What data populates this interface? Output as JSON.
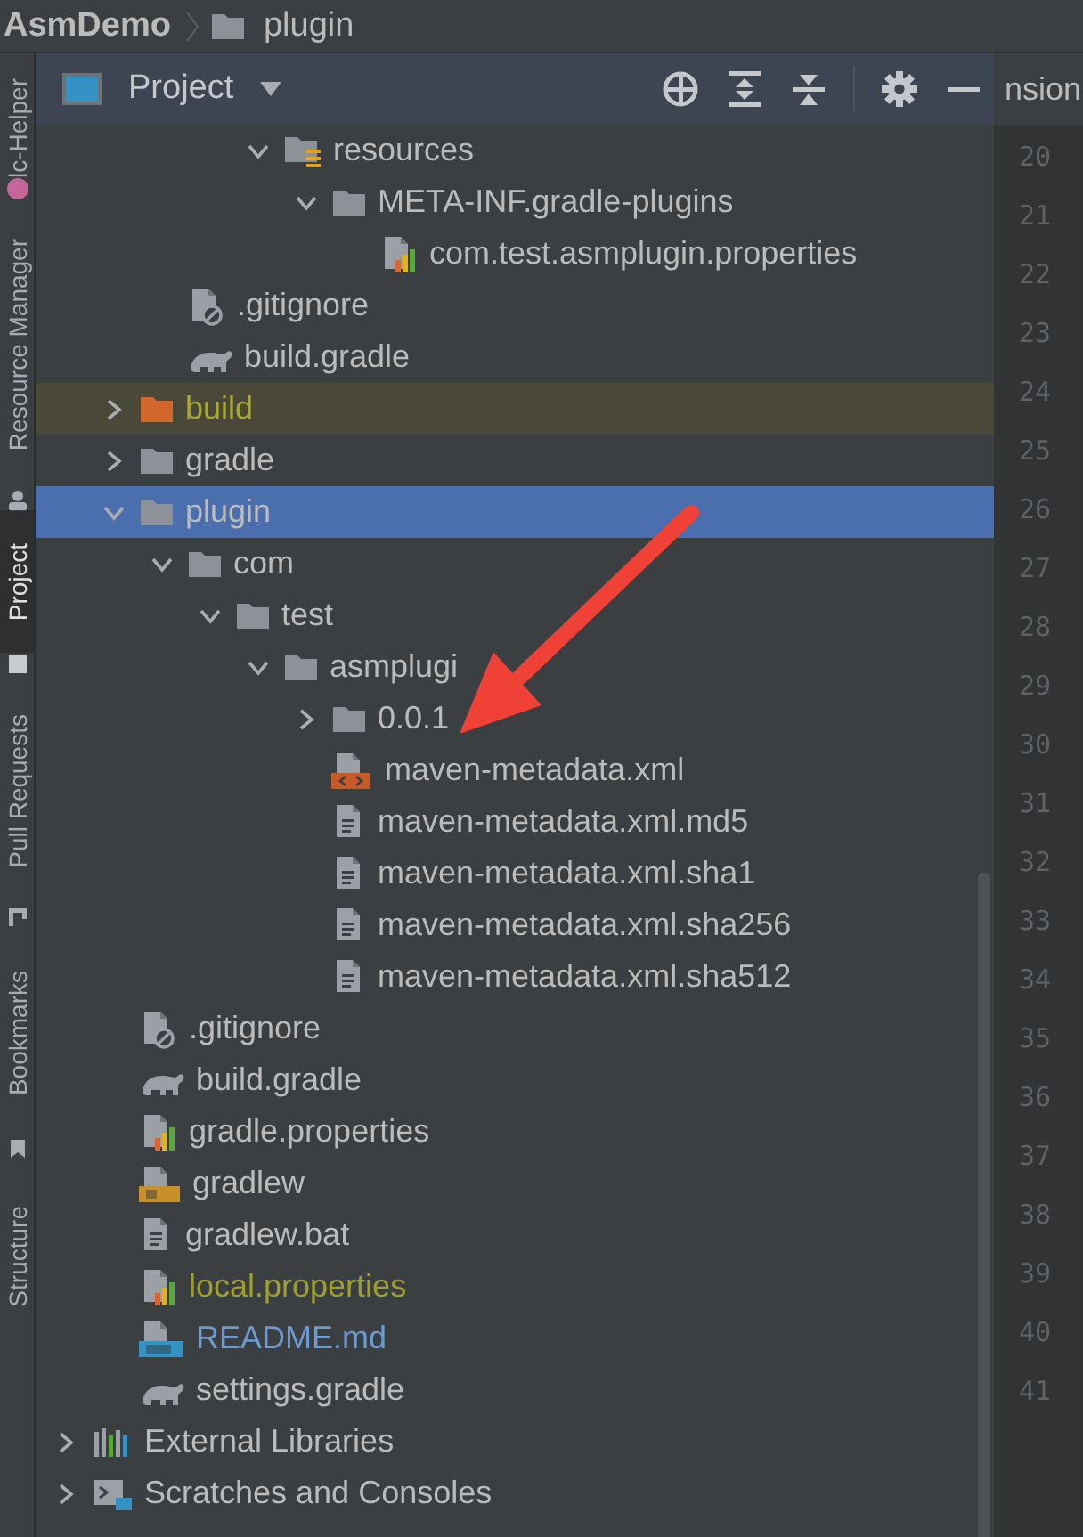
{
  "breadcrumb": [
    {
      "label": "AsmDemo",
      "kind": "project"
    },
    {
      "label": "plugin",
      "kind": "folder"
    }
  ],
  "tool_strip": [
    {
      "label": "lc-Helper",
      "selected": false
    },
    {
      "label": "Resource Manager",
      "selected": false
    },
    {
      "label": "Project",
      "selected": true
    },
    {
      "label": "Pull Requests",
      "selected": false
    },
    {
      "label": "Bookmarks",
      "selected": false
    },
    {
      "label": "Structure",
      "selected": false
    }
  ],
  "panel": {
    "title": "Project"
  },
  "editor_tab": {
    "label": "nsion"
  },
  "tree": {
    "items": [
      {
        "children": [
          {
            "children": [
              {
                "children": [
                  {
                    "children": [
                      {
                        "label": "resources",
                        "kind": "resources-folder",
                        "expanded": true,
                        "selected": false,
                        "highlighted": false,
                        "color": "#bbbbbb",
                        "children": [
                          {
                            "label": "META-INF.gradle-plugins",
                            "kind": "folder",
                            "expanded": true,
                            "selected": false,
                            "highlighted": false,
                            "color": "#bbbbbb",
                            "children": [
                              {
                                "label": "com.test.asmplugin.properties",
                                "kind": "properties",
                                "selected": false,
                                "highlighted": false,
                                "color": "#bbbbbb"
                              }
                            ]
                          }
                        ]
                      }
                    ]
                  }
                ]
              },
              {
                "label": ".gitignore",
                "kind": "gitignore",
                "selected": false,
                "highlighted": false,
                "color": "#bbbbbb"
              },
              {
                "label": "build.gradle",
                "kind": "gradle",
                "selected": false,
                "highlighted": false,
                "color": "#bbbbbb"
              }
            ]
          },
          {
            "label": "build",
            "kind": "folder",
            "expanded": false,
            "selected": false,
            "highlighted": true,
            "color": "#a9a830"
          },
          {
            "label": "gradle",
            "kind": "folder",
            "expanded": false,
            "selected": false,
            "highlighted": false,
            "color": "#bbbbbb"
          },
          {
            "label": "plugin",
            "kind": "folder",
            "expanded": true,
            "selected": true,
            "highlighted": false,
            "color": "#bbbbbb",
            "children": [
              {
                "label": "com",
                "kind": "folder",
                "expanded": true,
                "selected": false,
                "highlighted": false,
                "color": "#bbbbbb",
                "children": [
                  {
                    "label": "test",
                    "kind": "folder",
                    "expanded": true,
                    "selected": false,
                    "highlighted": false,
                    "color": "#bbbbbb",
                    "children": [
                      {
                        "label": "asmplugi",
                        "kind": "folder",
                        "expanded": true,
                        "selected": false,
                        "highlighted": false,
                        "color": "#bbbbbb",
                        "children": [
                          {
                            "label": "0.0.1",
                            "kind": "folder",
                            "expanded": false,
                            "selected": false,
                            "highlighted": false,
                            "color": "#bbbbbb"
                          },
                          {
                            "label": "maven-metadata.xml",
                            "kind": "xml",
                            "selected": false,
                            "highlighted": false,
                            "color": "#bbbbbb"
                          },
                          {
                            "label": "maven-metadata.xml.md5",
                            "kind": "text",
                            "selected": false,
                            "highlighted": false,
                            "color": "#bbbbbb"
                          },
                          {
                            "label": "maven-metadata.xml.sha1",
                            "kind": "text",
                            "selected": false,
                            "highlighted": false,
                            "color": "#bbbbbb"
                          },
                          {
                            "label": "maven-metadata.xml.sha256",
                            "kind": "text",
                            "selected": false,
                            "highlighted": false,
                            "color": "#bbbbbb"
                          },
                          {
                            "label": "maven-metadata.xml.sha512",
                            "kind": "text",
                            "selected": false,
                            "highlighted": false,
                            "color": "#bbbbbb"
                          }
                        ]
                      }
                    ]
                  }
                ]
              }
            ]
          },
          {
            "label": ".gitignore",
            "kind": "gitignore",
            "selected": false,
            "highlighted": false,
            "color": "#bbbbbb"
          },
          {
            "label": "build.gradle",
            "kind": "gradle",
            "selected": false,
            "highlighted": false,
            "color": "#bbbbbb"
          },
          {
            "label": "gradle.properties",
            "kind": "properties",
            "selected": false,
            "highlighted": false,
            "color": "#bbbbbb"
          },
          {
            "label": "gradlew",
            "kind": "shell",
            "selected": false,
            "highlighted": false,
            "color": "#bbbbbb"
          },
          {
            "label": "gradlew.bat",
            "kind": "text",
            "selected": false,
            "highlighted": false,
            "color": "#bbbbbb"
          },
          {
            "label": "local.properties",
            "kind": "properties",
            "selected": false,
            "highlighted": false,
            "color": "#9ea02a"
          },
          {
            "label": "README.md",
            "kind": "markdown",
            "selected": false,
            "highlighted": false,
            "color": "#6a9bd1"
          },
          {
            "label": "settings.gradle",
            "kind": "gradle",
            "selected": false,
            "highlighted": false,
            "color": "#bbbbbb"
          }
        ]
      },
      {
        "label": "External Libraries",
        "kind": "libraries",
        "expanded": false,
        "selected": false,
        "highlighted": false,
        "color": "#bbbbbb"
      },
      {
        "label": "Scratches and Consoles",
        "kind": "scratches",
        "expanded": false,
        "selected": false,
        "highlighted": false,
        "color": "#bbbbbb"
      }
    ]
  },
  "line_numbers": [
    "20",
    "21",
    "22",
    "23",
    "24",
    "25",
    "26",
    "27",
    "28",
    "29",
    "30",
    "31",
    "32",
    "33",
    "34",
    "35",
    "36",
    "37",
    "38",
    "39",
    "40",
    "41"
  ]
}
